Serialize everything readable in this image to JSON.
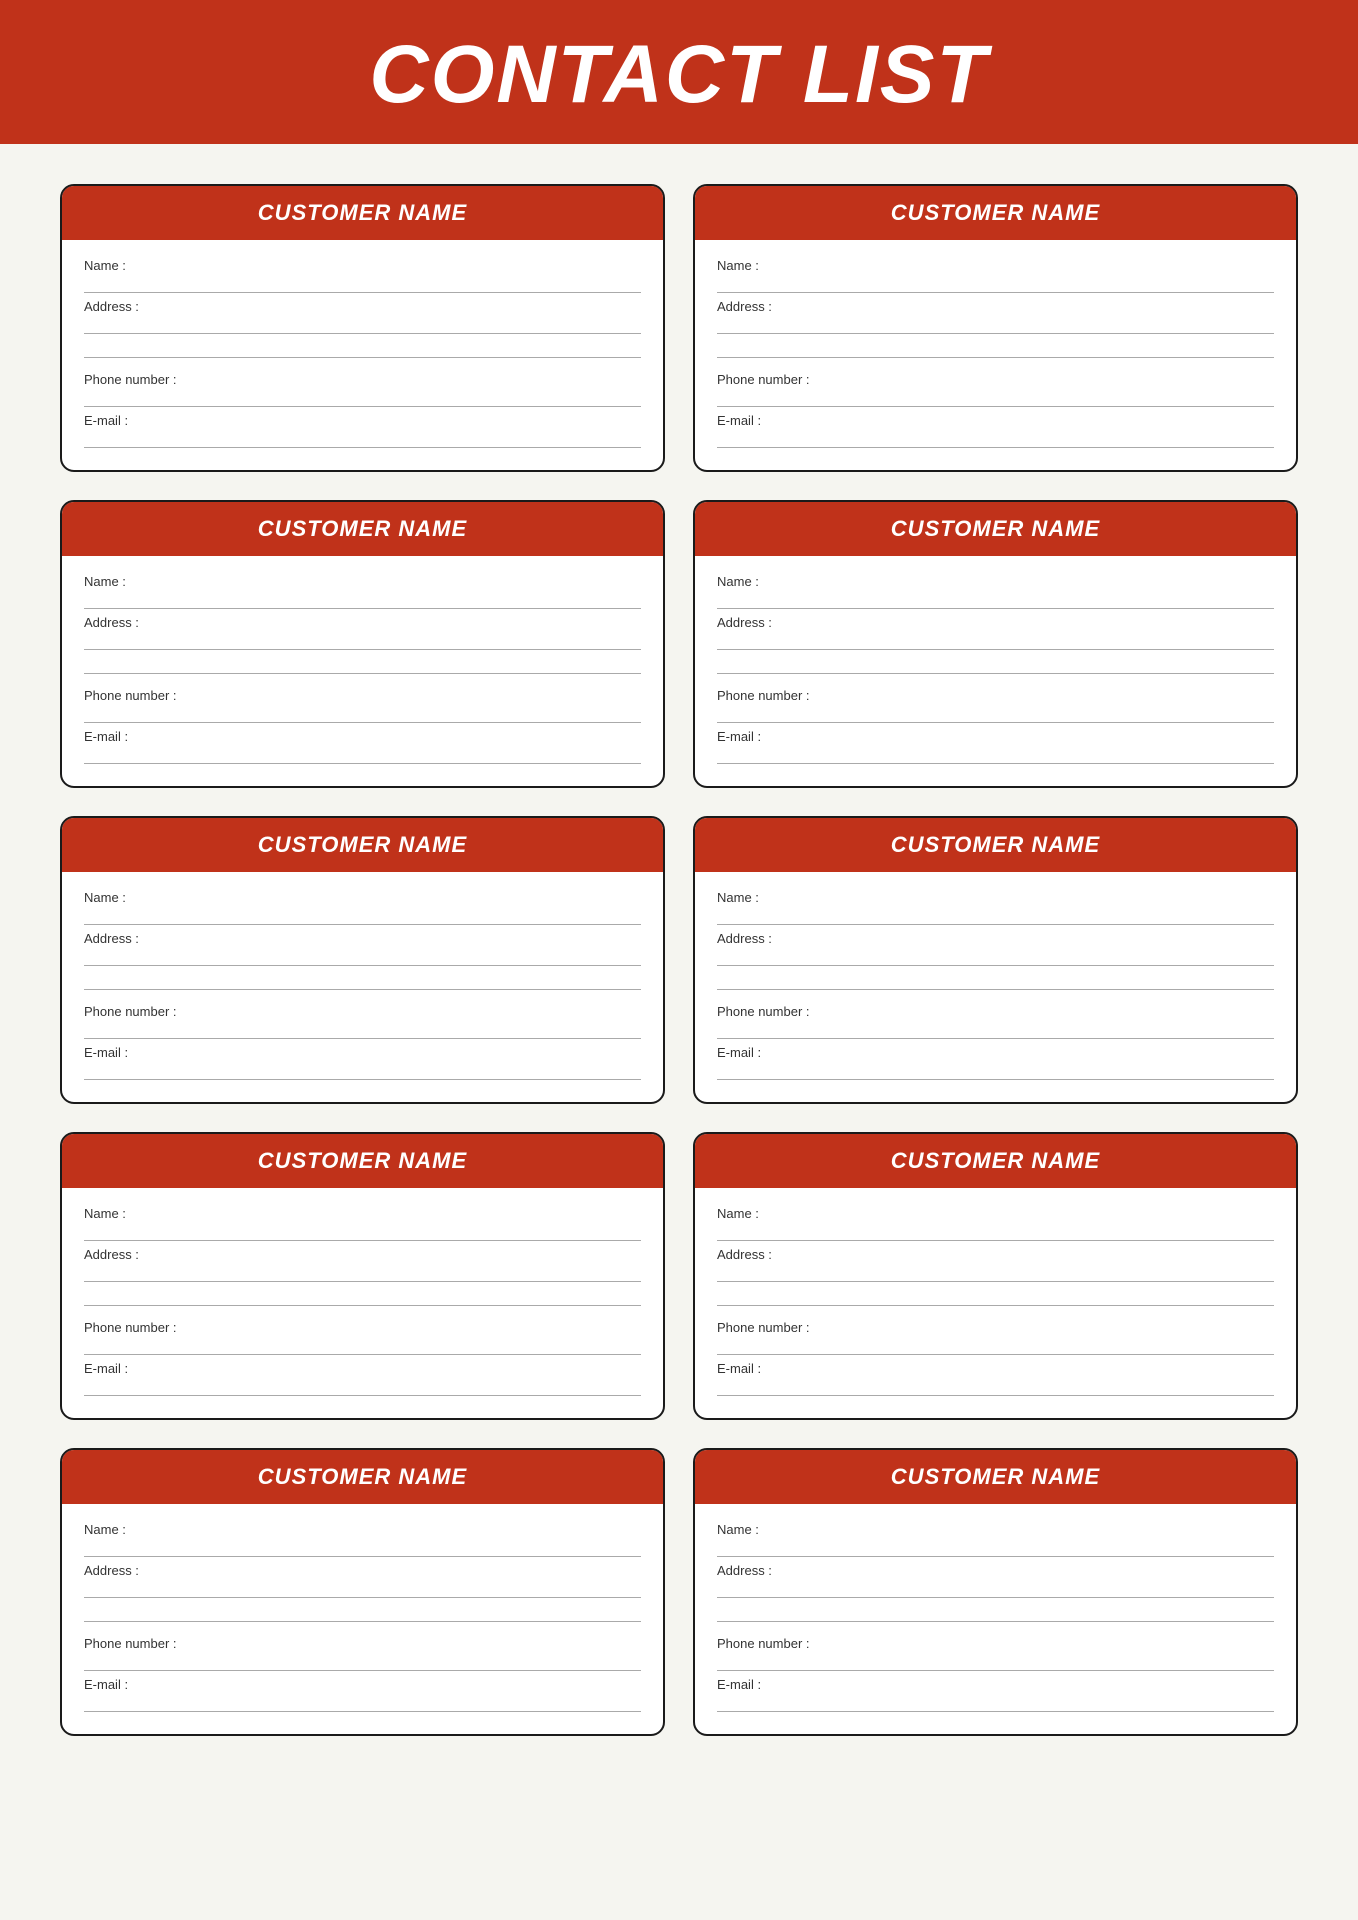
{
  "header": {
    "title": "CONTACT LIST",
    "bg_color": "#c0321a"
  },
  "card": {
    "header_label": "CUSTOMER NAME",
    "fields": {
      "name_label": "Name :",
      "address_label": "Address :",
      "phone_label": "Phone number :",
      "email_label": "E-mail :"
    }
  },
  "rows": [
    [
      0,
      1
    ],
    [
      2,
      3
    ],
    [
      4,
      5
    ],
    [
      6,
      7
    ],
    [
      8,
      9
    ]
  ]
}
